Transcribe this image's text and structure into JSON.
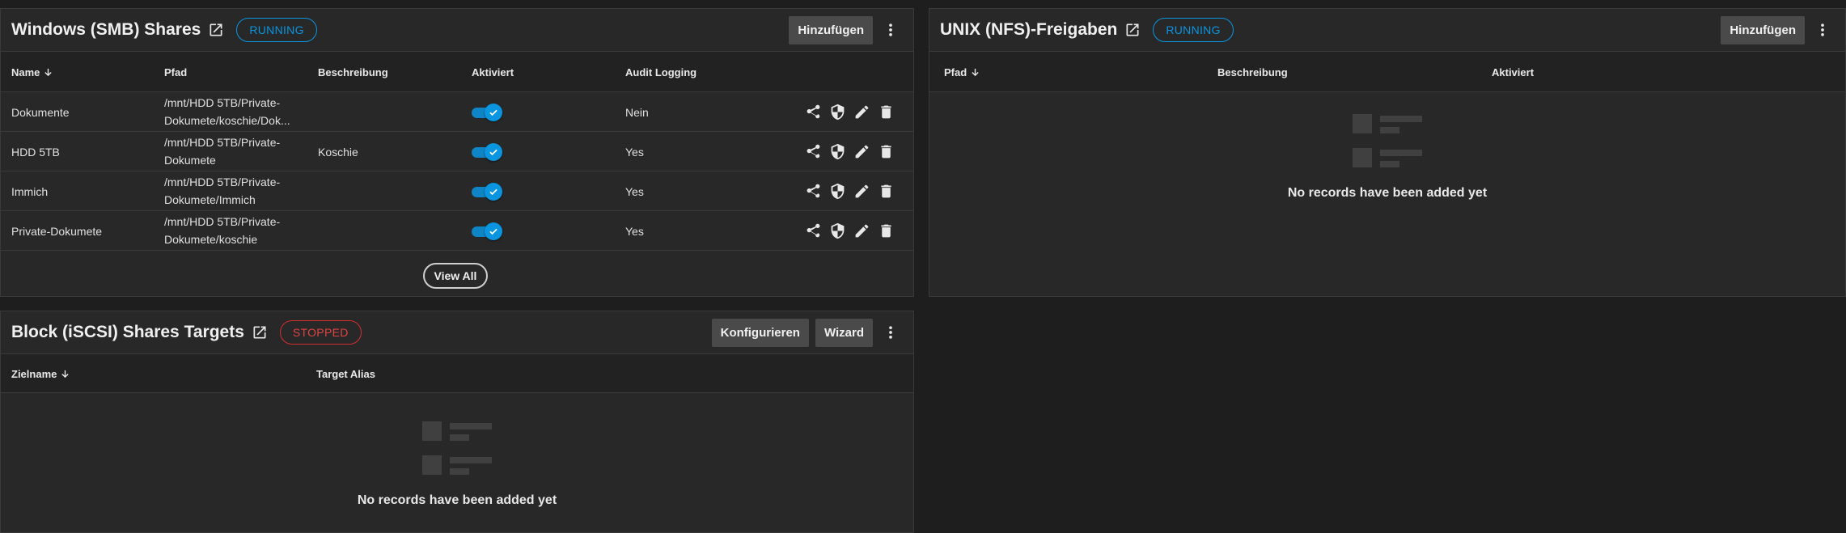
{
  "smb": {
    "title": "Windows (SMB) Shares",
    "status": "RUNNING",
    "add_label": "Hinzufügen",
    "columns": {
      "name": "Name",
      "path": "Pfad",
      "description": "Beschreibung",
      "enabled": "Aktiviert",
      "audit": "Audit Logging"
    },
    "rows": [
      {
        "name": "Dokumente",
        "path1": "/mnt/HDD 5TB/Private-",
        "path2": "Dokumete/koschie/Dok...",
        "description": "",
        "enabled": true,
        "audit": "Nein"
      },
      {
        "name": "HDD 5TB",
        "path1": "/mnt/HDD 5TB/Private-",
        "path2": "Dokumete",
        "description": "Koschie",
        "enabled": true,
        "audit": "Yes"
      },
      {
        "name": "Immich",
        "path1": "/mnt/HDD 5TB/Private-",
        "path2": "Dokumete/Immich",
        "description": "",
        "enabled": true,
        "audit": "Yes"
      },
      {
        "name": "Private-Dokumete",
        "path1": "/mnt/HDD 5TB/Private-",
        "path2": "Dokumete/koschie",
        "description": "",
        "enabled": true,
        "audit": "Yes"
      }
    ],
    "view_all_label": "View All"
  },
  "nfs": {
    "title": "UNIX (NFS)-Freigaben",
    "status": "RUNNING",
    "add_label": "Hinzufügen",
    "columns": {
      "path": "Pfad",
      "description": "Beschreibung",
      "enabled": "Aktiviert"
    },
    "empty_text": "No records have been added yet"
  },
  "iscsi": {
    "title": "Block (iSCSI) Shares Targets",
    "status": "STOPPED",
    "configure_label": "Konfigurieren",
    "wizard_label": "Wizard",
    "columns": {
      "target_name": "Zielname",
      "target_alias": "Target Alias"
    },
    "empty_text": "No records have been added yet"
  },
  "colors": {
    "accent": "#0a95e0",
    "stopped": "#d32f2f",
    "background": "#1e1e1e",
    "card": "#282828"
  },
  "icons": {
    "external_link": "open-in-new-icon",
    "menu": "dots-vertical-icon",
    "sort": "arrow-down-icon",
    "share": "share-icon",
    "acl": "shield-icon",
    "edit": "pencil-icon",
    "delete": "trash-icon",
    "empty": "list-placeholder-icon"
  }
}
